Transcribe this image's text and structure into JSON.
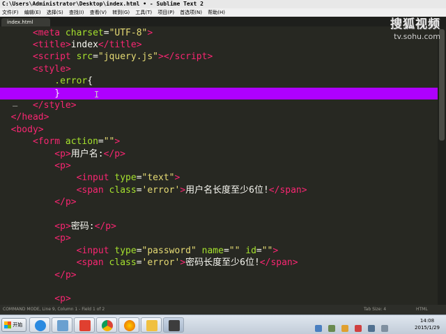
{
  "window": {
    "title": "C:\\Users\\Administrator\\Desktop\\index.html • - Sublime Text 2"
  },
  "menu": [
    "文件(F)",
    "编辑(E)",
    "选择(S)",
    "查找(I)",
    "查看(V)",
    "转到(G)",
    "工具(T)",
    "项目(P)",
    "首选项(N)",
    "帮助(H)"
  ],
  "tab": {
    "label": "index.html"
  },
  "watermark": {
    "logo": "搜狐视频",
    "url": "tv.sohu.com"
  },
  "code": {
    "l1": {
      "lt": "<",
      "tag": "meta",
      "attr": " charset",
      "eq": "=",
      "val": "\"UTF-8\"",
      "gt": ">"
    },
    "l2": {
      "lt1": "<",
      "tag1": "title",
      "gt1": ">",
      "text": "index",
      "lt2": "</",
      "tag2": "title",
      "gt2": ">"
    },
    "l3": {
      "lt1": "<",
      "tag1": "script",
      "attr": " src",
      "eq": "=",
      "val": "\"jquery.js\"",
      "gt1": ">",
      "lt2": "</",
      "tag2": "script",
      "gt2": ">"
    },
    "l4": {
      "lt": "<",
      "tag": "style",
      "gt": ">"
    },
    "l5": {
      "sel": ".error",
      "brace": "{"
    },
    "l6": {
      "brace": "}"
    },
    "l7": {
      "lt": "</",
      "tag": "style",
      "gt": ">"
    },
    "l8": {
      "lt": "</",
      "tag": "head",
      "gt": ">"
    },
    "l9": {
      "lt": "<",
      "tag": "body",
      "gt": ">"
    },
    "l10": {
      "lt": "<",
      "tag": "form",
      "attr": " action",
      "eq": "=",
      "val": "\"\"",
      "gt": ">"
    },
    "l11": {
      "lt1": "<",
      "tag1": "p",
      "gt1": ">",
      "text": "用户名:",
      "lt2": "</",
      "tag2": "p",
      "gt2": ">"
    },
    "l12": {
      "lt": "<",
      "tag": "p",
      "gt": ">"
    },
    "l13": {
      "lt": "<",
      "tag": "input",
      "attr": " type",
      "eq": "=",
      "val": "\"text\"",
      "gt": ">"
    },
    "l14": {
      "lt1": "<",
      "tag1": "span",
      "attr": " class",
      "eq": "=",
      "val": "'error'",
      "gt1": ">",
      "text": "用户名长度至少6位!",
      "lt2": "</",
      "tag2": "span",
      "gt2": ">"
    },
    "l15": {
      "lt": "</",
      "tag": "p",
      "gt": ">"
    },
    "l16": {
      "lt1": "<",
      "tag1": "p",
      "gt1": ">",
      "text": "密码:",
      "lt2": "</",
      "tag2": "p",
      "gt2": ">"
    },
    "l17": {
      "lt": "<",
      "tag": "p",
      "gt": ">"
    },
    "l18": {
      "lt": "<",
      "tag": "input",
      "attr1": " type",
      "eq1": "=",
      "val1": "\"password\"",
      "attr2": " name",
      "eq2": "=",
      "val2": "\"\"",
      "attr3": " id",
      "eq3": "=",
      "val3": "\"\"",
      "gt": ">"
    },
    "l19": {
      "lt1": "<",
      "tag1": "span",
      "attr": " class",
      "eq": "=",
      "val": "'error'",
      "gt1": ">",
      "text": "密码长度至少6位!",
      "lt2": "</",
      "tag2": "span",
      "gt2": ">"
    },
    "l20": {
      "lt": "</",
      "tag": "p",
      "gt": ">"
    },
    "l21": {
      "lt": "<",
      "tag": "p",
      "gt": ">"
    }
  },
  "gutter_mark": "_",
  "cursor_glyph": "I",
  "status": {
    "mode": "COMMAND MODE, Line 9, Column 1 - Field 1 of 2",
    "tab_size": "Tab Size: 4",
    "syntax": "HTML"
  },
  "taskbar": {
    "start_label": "开始",
    "time": "14:08",
    "date": "2015/1/29"
  },
  "colors": {
    "editor_bg": "#272822",
    "tag": "#f92672",
    "attr": "#a6e22e",
    "string": "#e6db74",
    "text": "#f8f8f2",
    "selection": "#ae00ff"
  }
}
